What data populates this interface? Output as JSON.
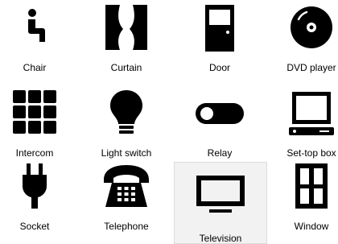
{
  "devices": [
    {
      "label": "Chair",
      "icon": "chair-icon"
    },
    {
      "label": "Curtain",
      "icon": "curtain-icon"
    },
    {
      "label": "Door",
      "icon": "door-icon"
    },
    {
      "label": "DVD player",
      "icon": "dvd-disc-icon"
    },
    {
      "label": "Intercom",
      "icon": "intercom-keypad-icon"
    },
    {
      "label": "Light switch",
      "icon": "light-bulb-icon"
    },
    {
      "label": "Relay",
      "icon": "toggle-switch-icon"
    },
    {
      "label": "Set-top box",
      "icon": "set-top-box-icon"
    },
    {
      "label": "Socket",
      "icon": "plug-icon"
    },
    {
      "label": "Telephone",
      "icon": "telephone-icon"
    },
    {
      "label": "Television",
      "icon": "television-icon"
    },
    {
      "label": "Window",
      "icon": "window-icon"
    }
  ],
  "selected": "Television",
  "colors": {
    "icon": "#000000",
    "selected_background": "#f2f2f2",
    "selected_border": "#dcdcdc"
  }
}
